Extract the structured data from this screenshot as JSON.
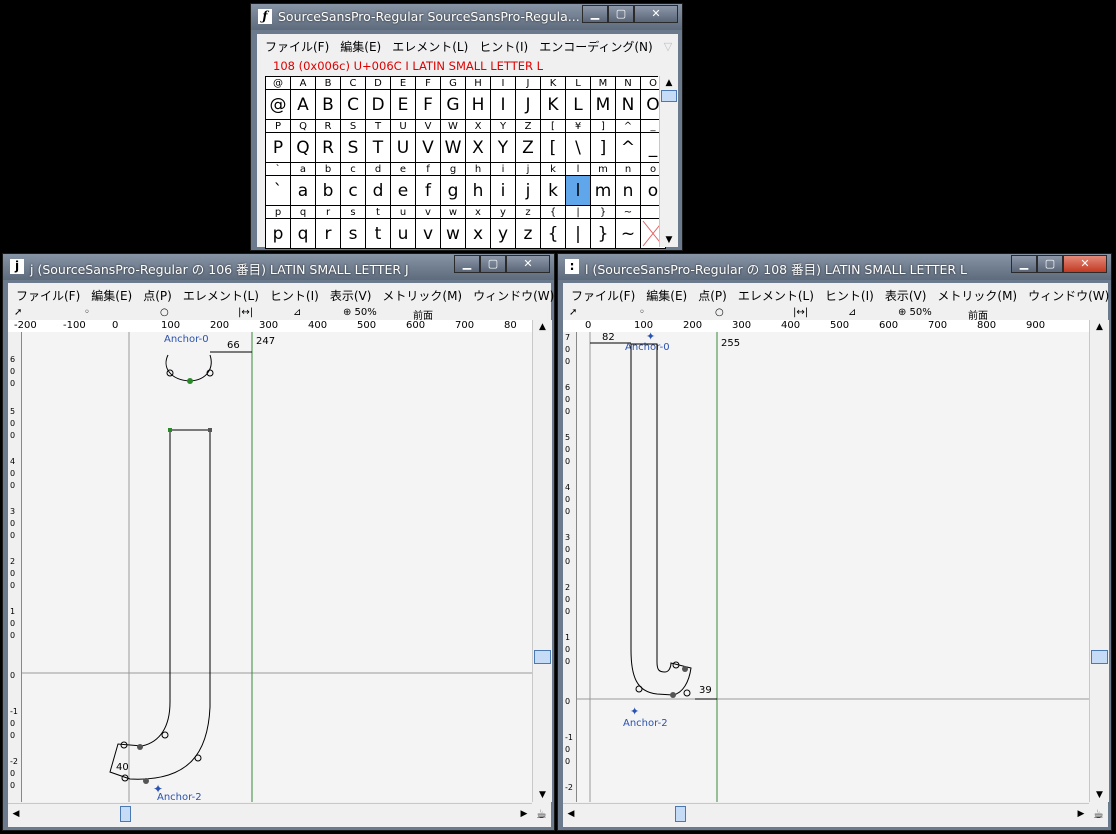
{
  "fontview": {
    "title": "SourceSansPro-Regular  SourceSansPro-Regula...",
    "menu": [
      "ファイル(F)",
      "編集(E)",
      "エレメント(L)",
      "ヒント(I)",
      "エンコーディング(N)"
    ],
    "status": "108   (0x006c) U+006C  I  LATIN SMALL LETTER L",
    "rows": [
      [
        "@",
        "A",
        "B",
        "C",
        "D",
        "E",
        "F",
        "G",
        "H",
        "I",
        "J",
        "K",
        "L",
        "M",
        "N",
        "O"
      ],
      [
        "P",
        "Q",
        "R",
        "S",
        "T",
        "U",
        "V",
        "W",
        "X",
        "Y",
        "Z",
        "[",
        "\\",
        "]",
        "^",
        "_"
      ],
      [
        "`",
        "a",
        "b",
        "c",
        "d",
        "e",
        "f",
        "g",
        "h",
        "i",
        "j",
        "k",
        "l",
        "m",
        "n",
        "o"
      ],
      [
        "p",
        "q",
        "r",
        "s",
        "t",
        "u",
        "v",
        "w",
        "x",
        "y",
        "z",
        "{",
        "|",
        "}",
        "~",
        ""
      ]
    ],
    "row_labels": [
      [
        "@",
        "A",
        "B",
        "C",
        "D",
        "E",
        "F",
        "G",
        "H",
        "I",
        "J",
        "K",
        "L",
        "M",
        "N",
        "O"
      ],
      [
        "P",
        "Q",
        "R",
        "S",
        "T",
        "U",
        "V",
        "W",
        "X",
        "Y",
        "Z",
        "[",
        "¥",
        "]",
        "^",
        "_"
      ],
      [
        "`",
        "a",
        "b",
        "c",
        "d",
        "e",
        "f",
        "g",
        "h",
        "i",
        "j",
        "k",
        "l",
        "m",
        "n",
        "o"
      ],
      [
        "p",
        "q",
        "r",
        "s",
        "t",
        "u",
        "v",
        "w",
        "x",
        "y",
        "z",
        "{",
        "|",
        "}",
        "~",
        ""
      ]
    ],
    "selected": "l"
  },
  "glyph_j": {
    "title": "j (SourceSansPro-Regular の 106 番目) LATIN SMALL LETTER J",
    "icon": "j",
    "menu": [
      "ファイル(F)",
      "編集(E)",
      "点(P)",
      "エレメント(L)",
      "ヒント(I)",
      "表示(V)",
      "メトリック(M)",
      "ウィンドウ(W)"
    ],
    "tools": [
      "◦",
      "○",
      "|↔|",
      "⊿",
      "⊕ 50%",
      "前面"
    ],
    "ruler_labels": [
      "-200",
      "-100",
      "0",
      "100",
      "200",
      "300",
      "400",
      "500",
      "600",
      "700",
      "80"
    ],
    "anchor_top": "Anchor-0",
    "anchor_bottom": "Anchor-2",
    "width_label": "66",
    "advance_label": "247",
    "bottom_label": "40"
  },
  "glyph_l": {
    "title": "l (SourceSansPro-Regular の 108 番目) LATIN SMALL LETTER L",
    "icon": ":",
    "menu": [
      "ファイル(F)",
      "編集(E)",
      "点(P)",
      "エレメント(L)",
      "ヒント(I)",
      "表示(V)",
      "メトリック(M)",
      "ウィンドウ(W)"
    ],
    "tools": [
      "◦",
      "○",
      "|↔|",
      "⊿",
      "⊕ 50%",
      "前面"
    ],
    "ruler_labels": [
      "0",
      "100",
      "200",
      "300",
      "400",
      "500",
      "600",
      "700",
      "800",
      "900"
    ],
    "anchor_top": "Anchor-0",
    "anchor_bottom": "Anchor-2",
    "left_label": "82",
    "advance_label": "255",
    "right_label": "39"
  }
}
